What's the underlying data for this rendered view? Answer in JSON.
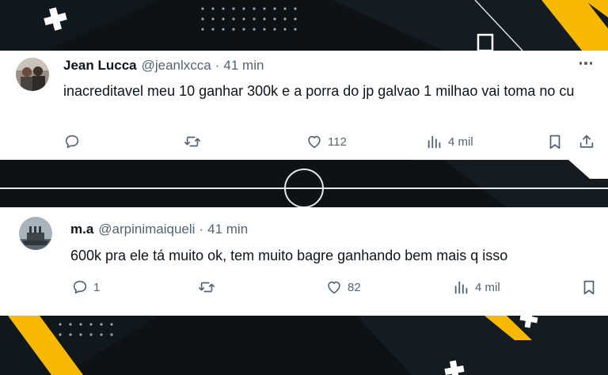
{
  "tweets": [
    {
      "name": "Jean Lucca",
      "handle": "@jeanlxcca",
      "separator": "·",
      "time": "41 min",
      "text": "inacreditavel meu 10 ganhar 300k e a porra do jp galvao 1 milhao vai toma no cu",
      "replies": "",
      "retweets": "",
      "likes": "112",
      "views": "4 mil"
    },
    {
      "name": "m.a",
      "handle": "@arpinimaiqueli",
      "separator": "·",
      "time": "41 min",
      "text": "600k pra ele tá muito ok, tem muito bagre ganhando bem mais q isso",
      "replies": "1",
      "retweets": "",
      "likes": "82",
      "views": "4 mil"
    }
  ],
  "icons": {
    "reply": "reply-icon",
    "retweet": "retweet-icon",
    "like": "heart-icon",
    "views": "views-icon",
    "bookmark": "bookmark-icon",
    "share": "share-icon",
    "more": "more-icon"
  },
  "colors": {
    "background": "#0d1216",
    "accent_yellow": "#f6b800",
    "secondary_text": "#536471",
    "primary_text": "#0f1419"
  }
}
